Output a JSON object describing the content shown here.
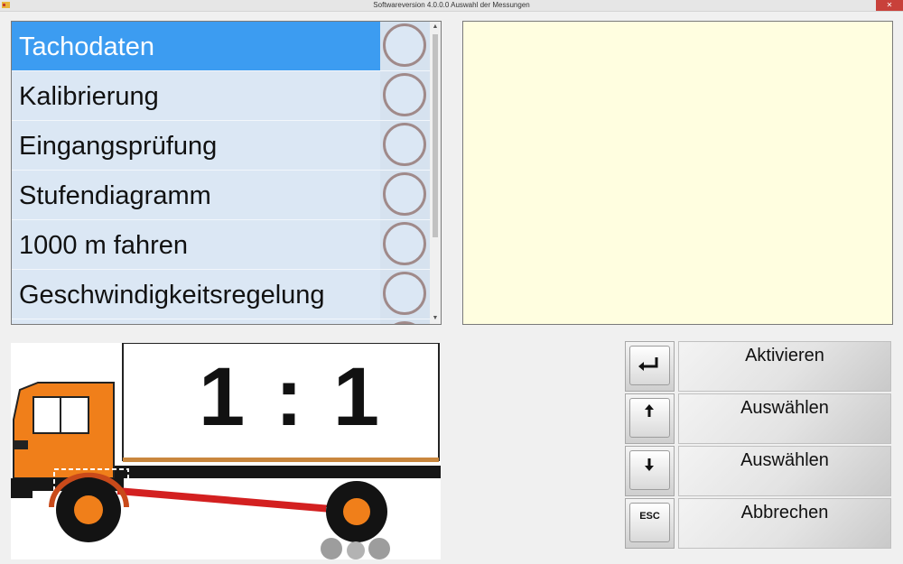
{
  "window": {
    "title": "Softwareversion 4.0.0.0  Auswahl der Messungen"
  },
  "measurements": {
    "items": [
      {
        "label": "Tachodaten",
        "selected": true
      },
      {
        "label": "Kalibrierung",
        "selected": false
      },
      {
        "label": "Eingangsprüfung",
        "selected": false
      },
      {
        "label": "Stufendiagramm",
        "selected": false
      },
      {
        "label": "1000 m fahren",
        "selected": false
      },
      {
        "label": "Geschwindigkeitsregelung",
        "selected": false
      }
    ]
  },
  "preview": {
    "ratio": "1 : 1",
    "colors": {
      "cab": "#f07f1a",
      "axle": "#d32020",
      "wheel_hub": "#f07f1a"
    }
  },
  "buttons": [
    {
      "key": "↵",
      "key_icon": "enter-key-icon",
      "label": "Aktivieren"
    },
    {
      "key": "↑",
      "key_icon": "arrow-up-key-icon",
      "label": "Auswählen"
    },
    {
      "key": "↓",
      "key_icon": "arrow-down-key-icon",
      "label": "Auswählen"
    },
    {
      "key": "ESC",
      "key_icon": "esc-key-icon",
      "label": "Abbrechen"
    }
  ],
  "colors": {
    "selection": "#3c9cf1",
    "row": "#dbe7f4",
    "info_panel": "#fffee0"
  }
}
